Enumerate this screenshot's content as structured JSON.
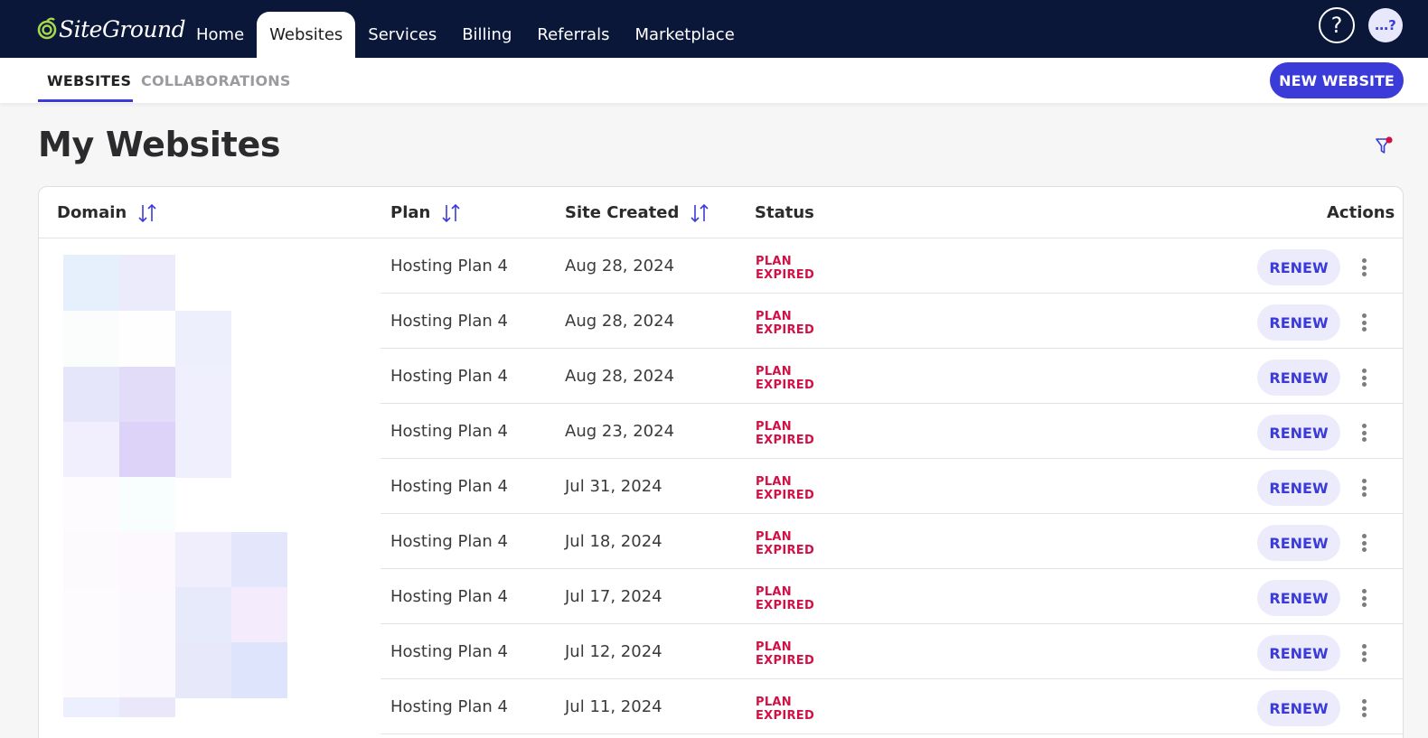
{
  "brand": {
    "name": "SiteGround"
  },
  "nav": {
    "items": [
      {
        "label": "Home"
      },
      {
        "label": "Websites"
      },
      {
        "label": "Services"
      },
      {
        "label": "Billing"
      },
      {
        "label": "Referrals"
      },
      {
        "label": "Marketplace"
      }
    ],
    "help_label": "?",
    "avatar_initials": "…?"
  },
  "subnav": {
    "tabs": [
      {
        "label": "WEBSITES"
      },
      {
        "label": "COLLABORATIONS"
      }
    ],
    "new_button": "NEW WEBSITE"
  },
  "page": {
    "title": "My Websites"
  },
  "table": {
    "headers": {
      "domain": "Domain",
      "plan": "Plan",
      "created": "Site Created",
      "status": "Status",
      "actions": "Actions"
    },
    "rows": [
      {
        "plan": "Hosting Plan 4",
        "created": "Aug 28, 2024",
        "status_line1": "PLAN",
        "status_line2": "EXPIRED",
        "action": "RENEW"
      },
      {
        "plan": "Hosting Plan 4",
        "created": "Aug 28, 2024",
        "status_line1": "PLAN",
        "status_line2": "EXPIRED",
        "action": "RENEW"
      },
      {
        "plan": "Hosting Plan 4",
        "created": "Aug 28, 2024",
        "status_line1": "PLAN",
        "status_line2": "EXPIRED",
        "action": "RENEW"
      },
      {
        "plan": "Hosting Plan 4",
        "created": "Aug 23, 2024",
        "status_line1": "PLAN",
        "status_line2": "EXPIRED",
        "action": "RENEW"
      },
      {
        "plan": "Hosting Plan 4",
        "created": "Jul 31, 2024",
        "status_line1": "PLAN",
        "status_line2": "EXPIRED",
        "action": "RENEW"
      },
      {
        "plan": "Hosting Plan 4",
        "created": "Jul 18, 2024",
        "status_line1": "PLAN",
        "status_line2": "EXPIRED",
        "action": "RENEW"
      },
      {
        "plan": "Hosting Plan 4",
        "created": "Jul 17, 2024",
        "status_line1": "PLAN",
        "status_line2": "EXPIRED",
        "action": "RENEW"
      },
      {
        "plan": "Hosting Plan 4",
        "created": "Jul 12, 2024",
        "status_line1": "PLAN",
        "status_line2": "EXPIRED",
        "action": "RENEW"
      },
      {
        "plan": "Hosting Plan 4",
        "created": "Jul 11, 2024",
        "status_line1": "PLAN",
        "status_line2": "EXPIRED",
        "action": "RENEW"
      }
    ]
  },
  "colors": {
    "nav_bg": "#0b1739",
    "accent": "#3b3bd9",
    "status_expired": "#d11146",
    "renew_bg": "#ecebfc"
  },
  "icons": {
    "logo": "siteground-logo-icon",
    "help": "help-icon",
    "filter": "filter-icon",
    "sort": "sort-icon",
    "more": "more-vertical-icon"
  }
}
